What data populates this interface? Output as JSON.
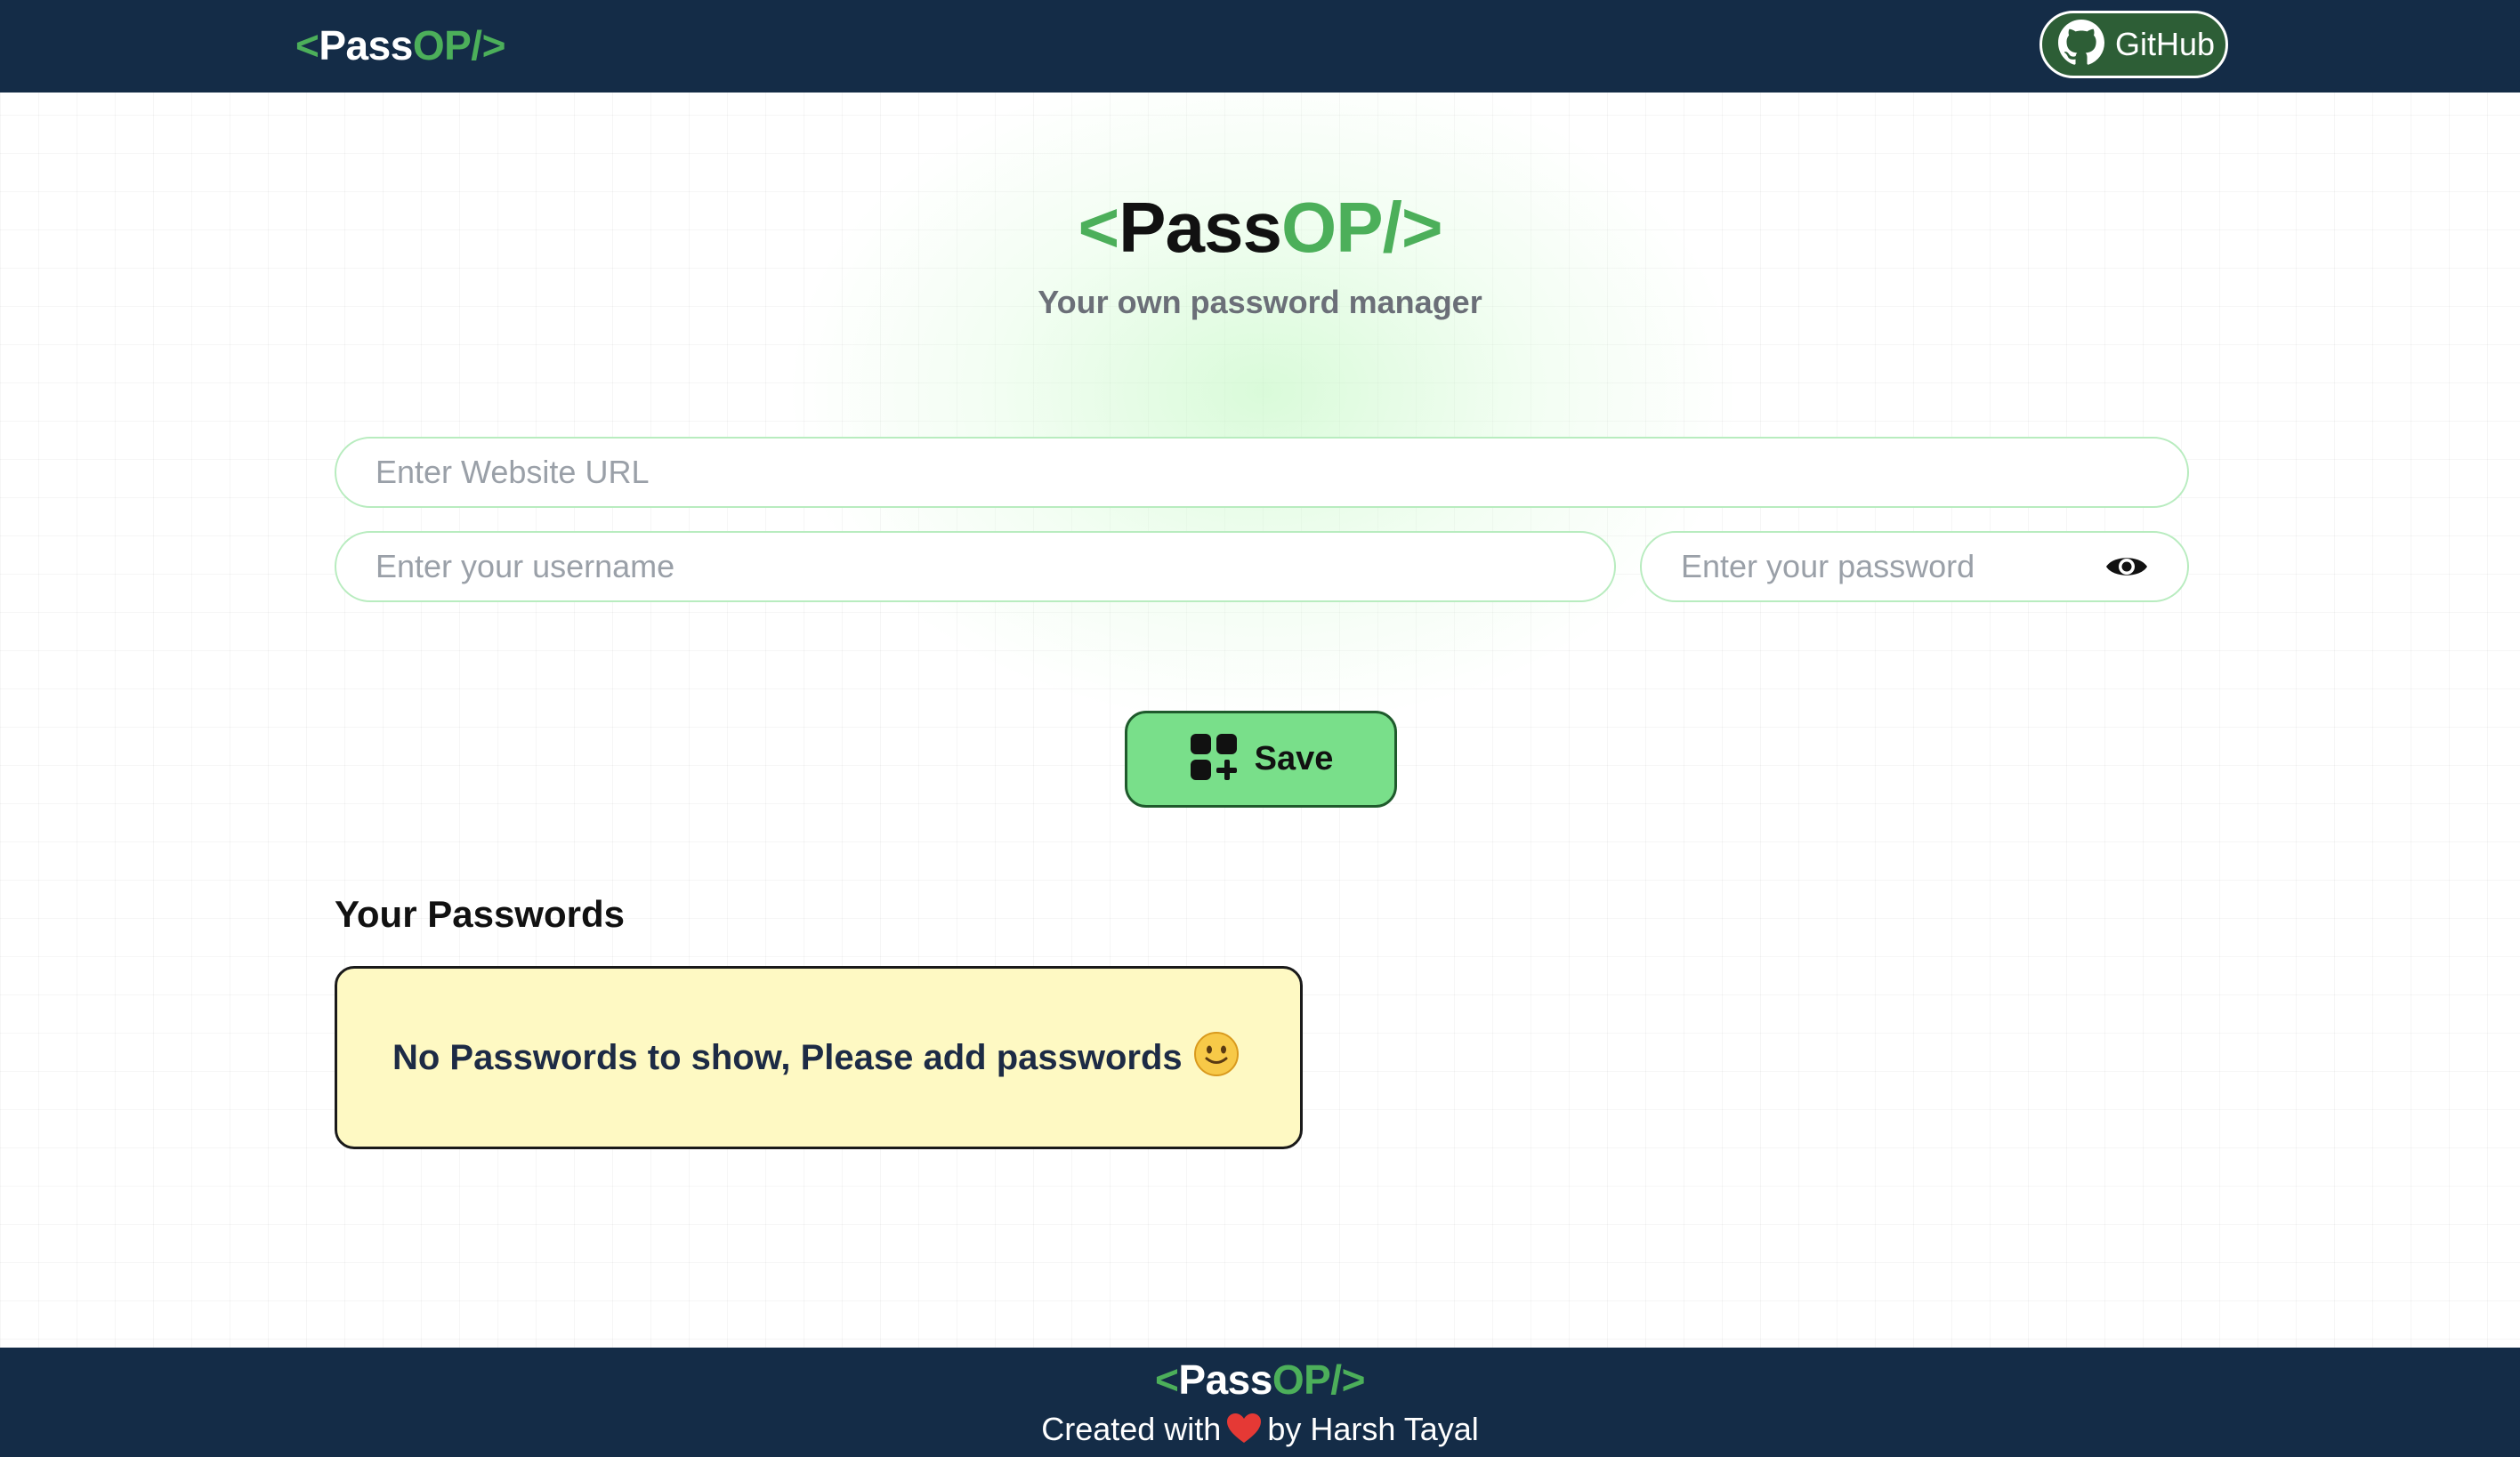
{
  "brand": {
    "open": "<",
    "pass": "Pass",
    "op": "OP/",
    "close": ">"
  },
  "navbar": {
    "github_label": "GitHub",
    "github_icon": "github-icon"
  },
  "hero": {
    "subtitle": "Your own password manager"
  },
  "form": {
    "url_placeholder": "Enter Website URL",
    "username_placeholder": "Enter your username",
    "password_placeholder": "Enter your password",
    "show_password_icon": "eye-icon",
    "save_label": "Save",
    "save_icon": "add-grid-icon"
  },
  "passwords": {
    "title": "Your Passwords",
    "empty_message": "No Passwords to show, Please add passwords",
    "empty_emoji": "slightly-smiling-face"
  },
  "footer": {
    "credit_before": "Created with",
    "credit_after": "by Harsh Tayal",
    "heart_icon": "heart-icon"
  },
  "colors": {
    "navbar_bg": "#142c47",
    "brand_green": "#4caf5a",
    "save_bg": "#79df8a",
    "empty_bg": "#fef9c3",
    "input_border": "#b8ecbf"
  }
}
